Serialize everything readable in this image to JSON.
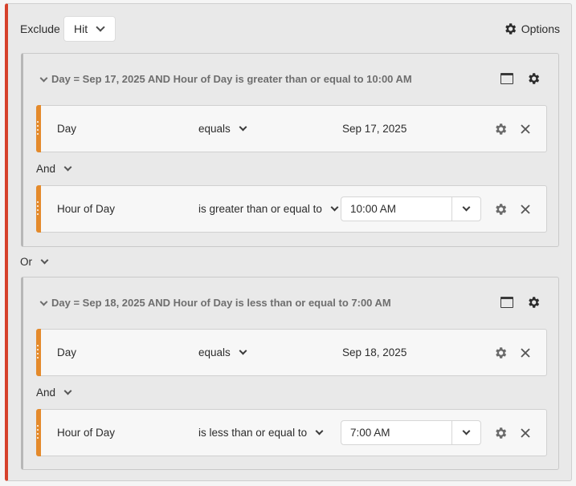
{
  "toolbar": {
    "exclude_label": "Exclude",
    "scope_value": "Hit",
    "options_label": "Options",
    "options_icon": "gear-icon"
  },
  "connector_or": "Or",
  "containers": [
    {
      "title": "Day = Sep 17, 2025 AND Hour of Day is greater than or equal to 10:00 AM",
      "and_label": "And",
      "rules": [
        {
          "dimension": "Day",
          "operator": "equals",
          "value": "Sep 17, 2025",
          "value_type": "text"
        },
        {
          "dimension": "Hour of Day",
          "operator": "is greater than or equal to",
          "value": "10:00 AM",
          "value_type": "dropdown"
        }
      ]
    },
    {
      "title": "Day = Sep 18, 2025 AND Hour of Day is less than or equal to 7:00 AM",
      "and_label": "And",
      "rules": [
        {
          "dimension": "Day",
          "operator": "equals",
          "value": "Sep 18, 2025",
          "value_type": "text"
        },
        {
          "dimension": "Hour of Day",
          "operator": "is less than or equal to",
          "value": "7:00 AM",
          "value_type": "dropdown"
        }
      ]
    }
  ],
  "colors": {
    "accent_left": "#d6412b",
    "rule_handle": "#e48a2b"
  }
}
